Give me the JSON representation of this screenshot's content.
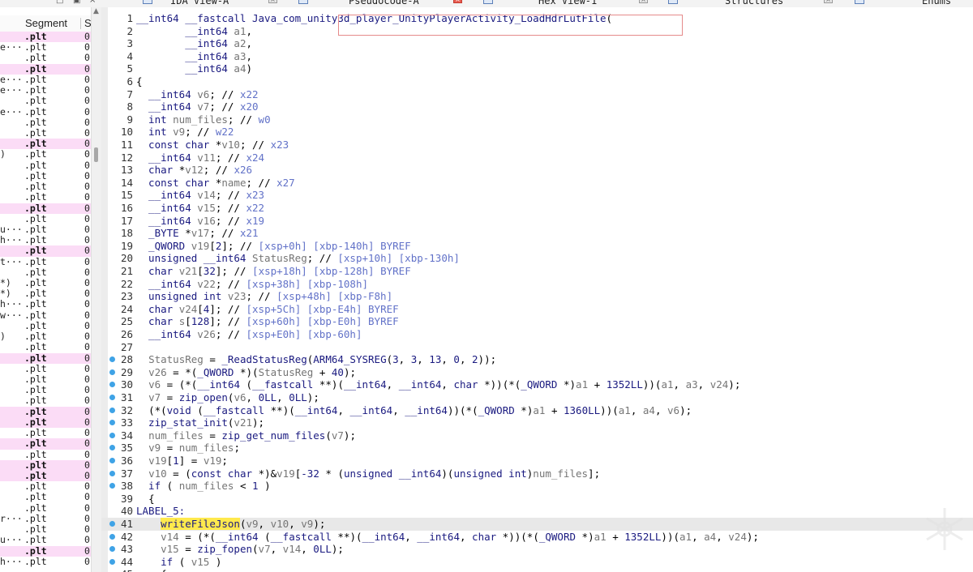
{
  "tabs": [
    {
      "label": "IDA View-A",
      "close": "×",
      "active": false
    },
    {
      "label": "Pseudocode-A",
      "close": "×",
      "active": true
    },
    {
      "label": "Hex View-1",
      "close": "×",
      "active": false
    },
    {
      "label": "Structures",
      "close": "×",
      "active": false
    },
    {
      "label": "Enums",
      "close": "",
      "active": false
    }
  ],
  "window_buttons": {
    "restore": "□",
    "float": "▣",
    "close": "×"
  },
  "segments": {
    "header": {
      "name_col": "",
      "segment_col": "Segment",
      "start_col": "S"
    },
    "scroll_up": "▲",
    "rows": [
      {
        "name": "",
        "seg": ".plt",
        "start": "0",
        "hl": true
      },
      {
        "name": "e···",
        "seg": ".plt",
        "start": "0",
        "hl": false
      },
      {
        "name": "",
        "seg": ".plt",
        "start": "0",
        "hl": false
      },
      {
        "name": "",
        "seg": ".plt",
        "start": "0",
        "hl": true
      },
      {
        "name": "e···",
        "seg": ".plt",
        "start": "0",
        "hl": false
      },
      {
        "name": "e···",
        "seg": ".plt",
        "start": "0",
        "hl": false
      },
      {
        "name": "",
        "seg": ".plt",
        "start": "0",
        "hl": false
      },
      {
        "name": "e···",
        "seg": ".plt",
        "start": "0",
        "hl": false
      },
      {
        "name": "",
        "seg": ".plt",
        "start": "0",
        "hl": false
      },
      {
        "name": "",
        "seg": ".plt",
        "start": "0",
        "hl": false
      },
      {
        "name": "",
        "seg": ".plt",
        "start": "0",
        "hl": true
      },
      {
        "name": ")",
        "seg": ".plt",
        "start": "0",
        "hl": false
      },
      {
        "name": "",
        "seg": ".plt",
        "start": "0",
        "hl": false
      },
      {
        "name": "",
        "seg": ".plt",
        "start": "0",
        "hl": false
      },
      {
        "name": "",
        "seg": ".plt",
        "start": "0",
        "hl": false
      },
      {
        "name": "",
        "seg": ".plt",
        "start": "0",
        "hl": false
      },
      {
        "name": "",
        "seg": ".plt",
        "start": "0",
        "hl": true
      },
      {
        "name": "",
        "seg": ".plt",
        "start": "0",
        "hl": false
      },
      {
        "name": "u···",
        "seg": ".plt",
        "start": "0",
        "hl": false
      },
      {
        "name": "h···",
        "seg": ".plt",
        "start": "0",
        "hl": false
      },
      {
        "name": "",
        "seg": ".plt",
        "start": "0",
        "hl": true
      },
      {
        "name": "t···",
        "seg": ".plt",
        "start": "0",
        "hl": false
      },
      {
        "name": "",
        "seg": ".plt",
        "start": "0",
        "hl": false
      },
      {
        "name": "*)",
        "seg": ".plt",
        "start": "0",
        "hl": false
      },
      {
        "name": "*)",
        "seg": ".plt",
        "start": "0",
        "hl": false
      },
      {
        "name": "h···",
        "seg": ".plt",
        "start": "0",
        "hl": false
      },
      {
        "name": "w···",
        "seg": ".plt",
        "start": "0",
        "hl": false
      },
      {
        "name": "",
        "seg": ".plt",
        "start": "0",
        "hl": false
      },
      {
        "name": ")",
        "seg": ".plt",
        "start": "0",
        "hl": false
      },
      {
        "name": "",
        "seg": ".plt",
        "start": "0",
        "hl": false
      },
      {
        "name": "",
        "seg": ".plt",
        "start": "0",
        "hl": true
      },
      {
        "name": "",
        "seg": ".plt",
        "start": "0",
        "hl": false
      },
      {
        "name": "",
        "seg": ".plt",
        "start": "0",
        "hl": false
      },
      {
        "name": "",
        "seg": ".plt",
        "start": "0",
        "hl": false
      },
      {
        "name": "",
        "seg": ".plt",
        "start": "0",
        "hl": false
      },
      {
        "name": "",
        "seg": ".plt",
        "start": "0",
        "hl": true
      },
      {
        "name": "",
        "seg": ".plt",
        "start": "0",
        "hl": true
      },
      {
        "name": "",
        "seg": ".plt",
        "start": "0",
        "hl": false
      },
      {
        "name": "",
        "seg": ".plt",
        "start": "0",
        "hl": true
      },
      {
        "name": "",
        "seg": ".plt",
        "start": "0",
        "hl": false
      },
      {
        "name": "",
        "seg": ".plt",
        "start": "0",
        "hl": true
      },
      {
        "name": "",
        "seg": ".plt",
        "start": "0",
        "hl": true
      },
      {
        "name": "",
        "seg": ".plt",
        "start": "0",
        "hl": false
      },
      {
        "name": "",
        "seg": ".plt",
        "start": "0",
        "hl": false
      },
      {
        "name": "",
        "seg": ".plt",
        "start": "0",
        "hl": false
      },
      {
        "name": "r···",
        "seg": ".plt",
        "start": "0",
        "hl": false
      },
      {
        "name": "",
        "seg": ".plt",
        "start": "0",
        "hl": false
      },
      {
        "name": "u···",
        "seg": ".plt",
        "start": "0",
        "hl": false
      },
      {
        "name": "",
        "seg": ".plt",
        "start": "0",
        "hl": true
      },
      {
        "name": "h···",
        "seg": ".plt",
        "start": "0",
        "hl": false
      }
    ]
  },
  "code": {
    "highlight_word": "writeFileJson",
    "current_line": 41,
    "lines": [
      {
        "n": "1",
        "bp": false,
        "t": "__int64 __fastcall Java_com_unity3d_player_UnityPlayerActivity_LoadHdrLutFile("
      },
      {
        "n": "2",
        "bp": false,
        "t": "        __int64 a1,"
      },
      {
        "n": "3",
        "bp": false,
        "t": "        __int64 a2,"
      },
      {
        "n": "4",
        "bp": false,
        "t": "        __int64 a3,"
      },
      {
        "n": "5",
        "bp": false,
        "t": "        __int64 a4)"
      },
      {
        "n": "6",
        "bp": false,
        "t": "{"
      },
      {
        "n": "7",
        "bp": false,
        "t": "  __int64 v6; // x22"
      },
      {
        "n": "8",
        "bp": false,
        "t": "  __int64 v7; // x20"
      },
      {
        "n": "9",
        "bp": false,
        "t": "  int num_files; // w0"
      },
      {
        "n": "10",
        "bp": false,
        "t": "  int v9; // w22"
      },
      {
        "n": "11",
        "bp": false,
        "t": "  const char *v10; // x23"
      },
      {
        "n": "12",
        "bp": false,
        "t": "  __int64 v11; // x24"
      },
      {
        "n": "13",
        "bp": false,
        "t": "  char *v12; // x26"
      },
      {
        "n": "14",
        "bp": false,
        "t": "  const char *name; // x27"
      },
      {
        "n": "15",
        "bp": false,
        "t": "  __int64 v14; // x23"
      },
      {
        "n": "16",
        "bp": false,
        "t": "  __int64 v15; // x22"
      },
      {
        "n": "17",
        "bp": false,
        "t": "  __int64 v16; // x19"
      },
      {
        "n": "18",
        "bp": false,
        "t": "  _BYTE *v17; // x21"
      },
      {
        "n": "19",
        "bp": false,
        "t": "  _QWORD v19[2]; // [xsp+0h] [xbp-140h] BYREF"
      },
      {
        "n": "20",
        "bp": false,
        "t": "  unsigned __int64 StatusReg; // [xsp+10h] [xbp-130h]"
      },
      {
        "n": "21",
        "bp": false,
        "t": "  char v21[32]; // [xsp+18h] [xbp-128h] BYREF"
      },
      {
        "n": "22",
        "bp": false,
        "t": "  __int64 v22; // [xsp+38h] [xbp-108h]"
      },
      {
        "n": "23",
        "bp": false,
        "t": "  unsigned int v23; // [xsp+48h] [xbp-F8h]"
      },
      {
        "n": "24",
        "bp": false,
        "t": "  char v24[4]; // [xsp+5Ch] [xbp-E4h] BYREF"
      },
      {
        "n": "25",
        "bp": false,
        "t": "  char s[128]; // [xsp+60h] [xbp-E0h] BYREF"
      },
      {
        "n": "26",
        "bp": false,
        "t": "  __int64 v26; // [xsp+E0h] [xbp-60h]"
      },
      {
        "n": "27",
        "bp": false,
        "t": ""
      },
      {
        "n": "28",
        "bp": true,
        "t": "  StatusReg = _ReadStatusReg(ARM64_SYSREG(3, 3, 13, 0, 2));"
      },
      {
        "n": "29",
        "bp": true,
        "t": "  v26 = *(_QWORD *)(StatusReg + 40);"
      },
      {
        "n": "30",
        "bp": true,
        "t": "  v6 = (*(__int64 (__fastcall **)(__int64, __int64, char *))(*(_QWORD *)a1 + 1352LL))(a1, a3, v24);"
      },
      {
        "n": "31",
        "bp": true,
        "t": "  v7 = zip_open(v6, 0LL, 0LL);"
      },
      {
        "n": "32",
        "bp": true,
        "t": "  (*(void (__fastcall **)(__int64, __int64, __int64))(*(_QWORD *)a1 + 1360LL))(a1, a4, v6);"
      },
      {
        "n": "33",
        "bp": true,
        "t": "  zip_stat_init(v21);"
      },
      {
        "n": "34",
        "bp": true,
        "t": "  num_files = zip_get_num_files(v7);"
      },
      {
        "n": "35",
        "bp": true,
        "t": "  v9 = num_files;"
      },
      {
        "n": "36",
        "bp": true,
        "t": "  v19[1] = v19;"
      },
      {
        "n": "37",
        "bp": true,
        "t": "  v10 = (const char *)&v19[-32 * (unsigned __int64)(unsigned int)num_files];"
      },
      {
        "n": "38",
        "bp": true,
        "t": "  if ( num_files < 1 )"
      },
      {
        "n": "39",
        "bp": false,
        "t": "  {"
      },
      {
        "n": "40",
        "bp": false,
        "t": "LABEL_5:"
      },
      {
        "n": "41",
        "bp": true,
        "t": "    writeFileJson(v9, v10, v9);"
      },
      {
        "n": "42",
        "bp": true,
        "t": "    v14 = (*(__int64 (__fastcall **)(__int64, __int64, char *))(*(_QWORD *)a1 + 1352LL))(a1, a4, v24);"
      },
      {
        "n": "43",
        "bp": true,
        "t": "    v15 = zip_fopen(v7, v14, 0LL);"
      },
      {
        "n": "44",
        "bp": true,
        "t": "    if ( v15 )"
      },
      {
        "n": "45",
        "bp": false,
        "t": "    {"
      }
    ]
  },
  "watermark": {
    "text": "看雪"
  }
}
